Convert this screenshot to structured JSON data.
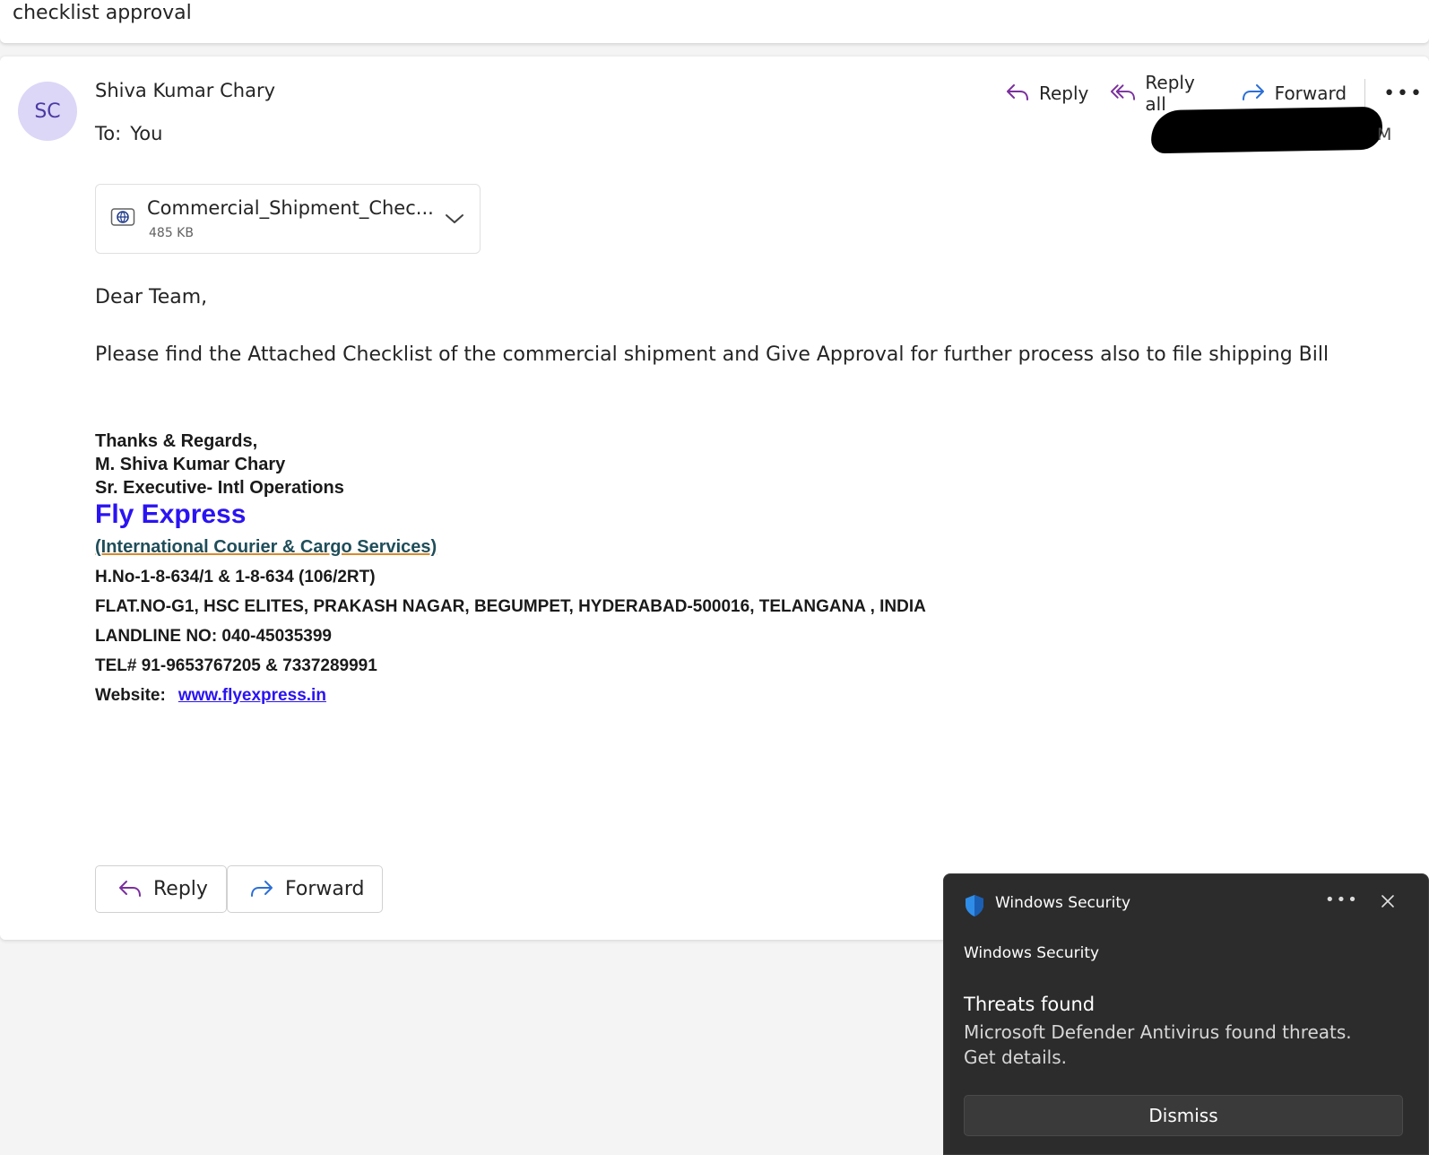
{
  "subject": "checklist approval",
  "sender": {
    "initials": "SC",
    "name": "Shiva Kumar Chary",
    "to_label": "To:",
    "to_value": "You",
    "date_tail": "M"
  },
  "actions": {
    "reply": "Reply",
    "reply_all": "Reply all",
    "forward": "Forward"
  },
  "attachment": {
    "name": "Commercial_Shipment_Chec...",
    "size": "485 KB"
  },
  "body": {
    "greeting": "Dear Team,",
    "message": "Please find the Attached Checklist of the commercial shipment and Give Approval for further process also to file shipping Bill"
  },
  "signature": {
    "regards": "Thanks & Regards,",
    "name": "M. Shiva Kumar Chary",
    "title": "Sr. Executive- Intl Operations",
    "company": "Fly Express",
    "services": "(International Courier & Cargo Services)",
    "address1": "H.No-1-8-634/1 & 1-8-634 (106/2RT)",
    "address2": "FLAT.NO-G1, HSC ELITES, PRAKASH NAGAR, BEGUMPET, HYDERABAD-500016, TELANGANA , INDIA",
    "landline": "LANDLINE NO: 040-45035399",
    "tel": "TEL# 91-9653767205 & 7337289991",
    "website_label": "Website:",
    "website": "www.flyexpress.in"
  },
  "footer_buttons": {
    "reply": "Reply",
    "forward": "Forward"
  },
  "toast": {
    "app": "Windows Security",
    "source": "Windows Security",
    "title": "Threats found",
    "message": "Microsoft Defender Antivirus found threats. Get details.",
    "dismiss": "Dismiss"
  },
  "colors": {
    "brand": "#2a13f2",
    "reply_icon": "#7a2f9e",
    "forward_icon": "#2b6fd6",
    "toast_bg": "#2c2c2c"
  },
  "icons": [
    "reply-icon",
    "reply-all-icon",
    "forward-icon",
    "more-icon",
    "attachment-web-icon",
    "chevron-down-icon",
    "shield-icon",
    "close-icon"
  ]
}
